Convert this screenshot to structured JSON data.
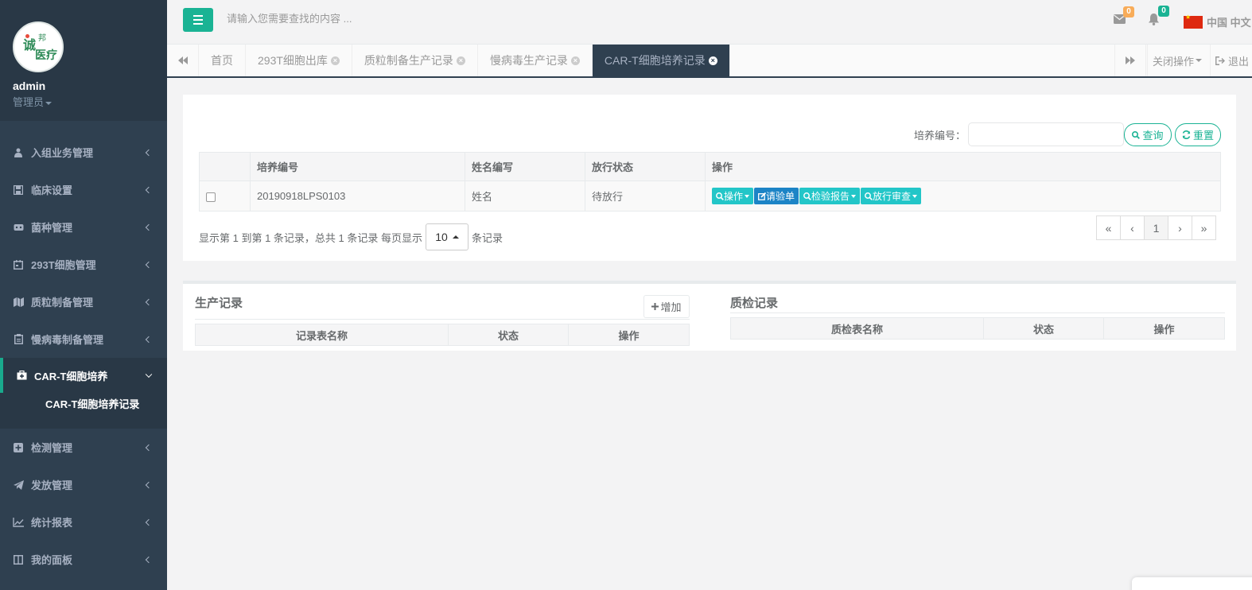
{
  "sidebar": {
    "username": "admin",
    "role": "管理员",
    "items": [
      {
        "label": "入组业务管理",
        "icon": "user-md-icon"
      },
      {
        "label": "临床设置",
        "icon": "save-icon"
      },
      {
        "label": "菌种管理",
        "icon": "tray-icon"
      },
      {
        "label": "293T细胞管理",
        "icon": "calendar-icon"
      },
      {
        "label": "质粒制备管理",
        "icon": "map-icon"
      },
      {
        "label": "慢病毒制备管理",
        "icon": "clipboard-icon"
      },
      {
        "label": "CAR-T细胞培养",
        "icon": "medkit-icon"
      },
      {
        "label": "检测管理",
        "icon": "plus-square-icon"
      },
      {
        "label": "发放管理",
        "icon": "paper-plane-icon"
      },
      {
        "label": "统计报表",
        "icon": "line-chart-icon"
      },
      {
        "label": "我的面板",
        "icon": "columns-icon"
      }
    ],
    "sub_item": "CAR-T细胞培养记录"
  },
  "topbar": {
    "search_placeholder": "请输入您需要查找的内容 ...",
    "mail_count": "0",
    "bell_count": "0",
    "language": "中国 中文"
  },
  "tabs": {
    "items": [
      "首页",
      "293T细胞出库",
      "质粒制备生产记录",
      "慢病毒生产记录",
      "CAR-T细胞培养记录"
    ],
    "close_ops": "关闭操作",
    "logout": "退出"
  },
  "filter": {
    "label": "培养编号：",
    "value": "",
    "search_btn": "查询",
    "reset_btn": "重置"
  },
  "table": {
    "headers": [
      "培养编号",
      "姓名编写",
      "放行状态",
      "操作"
    ],
    "rows": [
      {
        "id": "20190918LPS0103",
        "name": "姓名",
        "status": "待放行"
      }
    ],
    "ops": [
      "操作",
      "请验单",
      "检验报告",
      "放行审查"
    ]
  },
  "pagination": {
    "info_prefix": "显示第 1 到第 1 条记录，总共 1 条记录 每页显示",
    "page_size": "10",
    "info_suffix": "条记录",
    "first": "«",
    "prev": "‹",
    "current": "1",
    "next": "›",
    "last": "»"
  },
  "production": {
    "title": "生产记录",
    "add_btn": "增加",
    "headers": [
      "记录表名称",
      "状态",
      "操作"
    ]
  },
  "qc": {
    "title": "质检记录",
    "headers": [
      "质检表名称",
      "状态",
      "操作"
    ]
  }
}
